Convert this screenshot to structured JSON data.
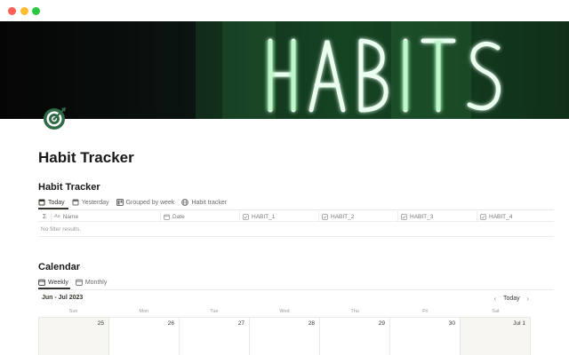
{
  "window": {
    "controls": [
      "close",
      "minimize",
      "maximize"
    ]
  },
  "cover": {
    "sign_text": "HABITS",
    "neon_color": "#5be37a"
  },
  "page": {
    "icon": "target-icon",
    "title": "Habit Tracker"
  },
  "habit_db": {
    "title": "Habit Tracker",
    "views": [
      {
        "label": "Today",
        "icon": "table-icon",
        "active": true
      },
      {
        "label": "Yesterday",
        "icon": "table-icon",
        "active": false
      },
      {
        "label": "Grouped by week",
        "icon": "board-icon",
        "active": false
      },
      {
        "label": "Habit tracker",
        "icon": "globe-icon",
        "active": false
      }
    ],
    "columns": [
      {
        "label": "",
        "icon": "sigma-icon"
      },
      {
        "label": "Name",
        "icon": "text-aa-icon"
      },
      {
        "label": "Date",
        "icon": "calendar-icon"
      },
      {
        "label": "HABIT_1",
        "icon": "checkbox-icon"
      },
      {
        "label": "HABIT_2",
        "icon": "checkbox-icon"
      },
      {
        "label": "HABIT_3",
        "icon": "checkbox-icon"
      },
      {
        "label": "HABIT_4",
        "icon": "checkbox-icon"
      }
    ],
    "empty_text": "No filter results."
  },
  "calendar": {
    "title": "Calendar",
    "views": [
      {
        "label": "Weekly",
        "icon": "calendar-icon",
        "active": true
      },
      {
        "label": "Monthly",
        "icon": "calendar-icon",
        "active": false
      }
    ],
    "range": "Jun - Jul 2023",
    "today_label": "Today",
    "weekdays": [
      "Sun",
      "Mon",
      "Tue",
      "Wed",
      "Thu",
      "Fri",
      "Sat"
    ],
    "days": [
      "25",
      "26",
      "27",
      "28",
      "29",
      "30",
      "Jul 1"
    ]
  }
}
